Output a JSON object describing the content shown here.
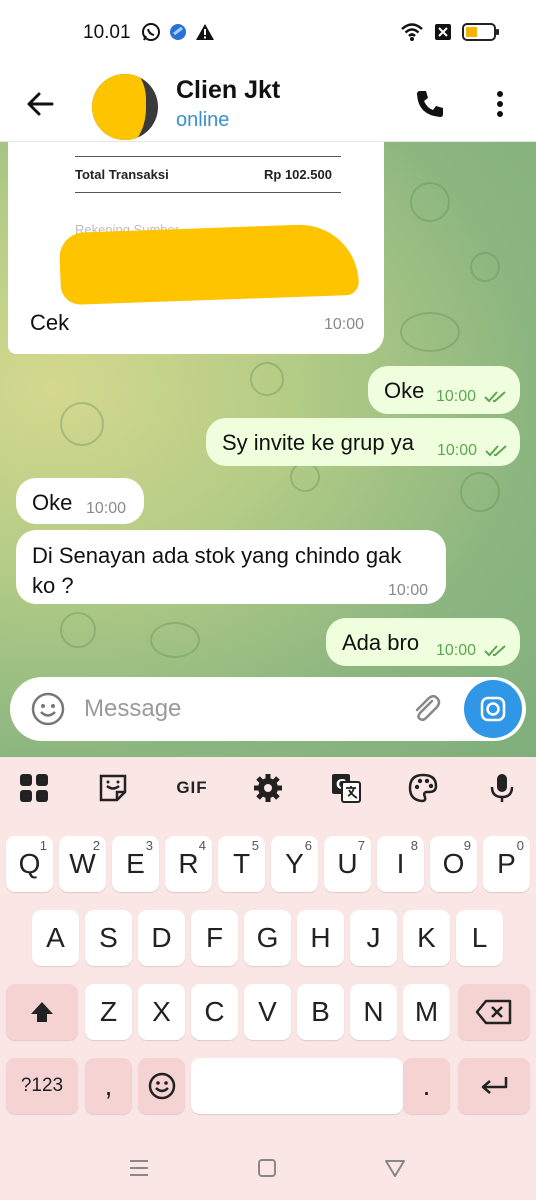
{
  "status_bar": {
    "time": "10.01",
    "icons": [
      "whatsapp-icon",
      "app-icon",
      "warning-icon",
      "wifi-icon",
      "no-sim-icon",
      "battery-icon"
    ]
  },
  "header": {
    "title": "Clien Jkt",
    "status": "online",
    "icons": [
      "back-arrow-icon",
      "phone-icon",
      "more-vert-icon"
    ]
  },
  "chat": {
    "forwarded_card": {
      "total_label": "Total Transaksi",
      "total_value": "Rp 102.500",
      "rekening_label": "Rekening Sumber",
      "caption": "Cek",
      "time": "10:00"
    },
    "messages": [
      {
        "direction": "out",
        "text": "Oke",
        "time": "10:00",
        "status": "read"
      },
      {
        "direction": "out",
        "text": "Sy invite ke grup ya",
        "time": "10:00",
        "status": "read"
      },
      {
        "direction": "in",
        "text": "Oke",
        "time": "10:00"
      },
      {
        "direction": "in",
        "text_line1": "Di Senayan ada stok yang chindo gak",
        "text_line2": "ko ?",
        "time": "10:00"
      },
      {
        "direction": "out",
        "text": "Ada bro",
        "time": "10:00",
        "status": "read"
      }
    ]
  },
  "composer": {
    "placeholder": "Message",
    "icons": [
      "emoji-icon",
      "attach-icon",
      "camera-icon"
    ]
  },
  "keyboard": {
    "toolbar": [
      "apps-grid-icon",
      "sticker-icon",
      "GIF",
      "settings-icon",
      "translate-icon",
      "palette-icon",
      "mic-icon"
    ],
    "gif_label": "GIF",
    "row1": [
      {
        "key": "Q",
        "hint": "1"
      },
      {
        "key": "W",
        "hint": "2"
      },
      {
        "key": "E",
        "hint": "3"
      },
      {
        "key": "R",
        "hint": "4"
      },
      {
        "key": "T",
        "hint": "5"
      },
      {
        "key": "Y",
        "hint": "6"
      },
      {
        "key": "U",
        "hint": "7"
      },
      {
        "key": "I",
        "hint": "8"
      },
      {
        "key": "O",
        "hint": "9"
      },
      {
        "key": "P",
        "hint": "0"
      }
    ],
    "row2": [
      "A",
      "S",
      "D",
      "F",
      "G",
      "H",
      "J",
      "K",
      "L"
    ],
    "row3": [
      "Z",
      "X",
      "C",
      "V",
      "B",
      "N",
      "M"
    ],
    "symbols_label": "?123",
    "comma_label": ",",
    "period_label": ".",
    "colors": {
      "key": "#ffffff",
      "special_key": "#f6d3d3",
      "background": "#fbe6e6"
    }
  },
  "nav_bar": {
    "icons": [
      "recents-icon",
      "home-icon",
      "back-icon"
    ]
  },
  "colors": {
    "outgoing_bubble": "#effedd",
    "incoming_bubble": "#ffffff",
    "accent_blue": "#3097e8",
    "read_tick": "#5ca853"
  }
}
